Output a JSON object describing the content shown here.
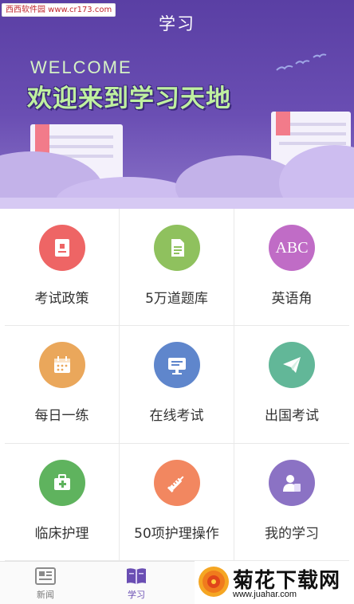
{
  "watermark_top": "西西软件园 www.cr173.com",
  "header": {
    "title": "学习"
  },
  "banner": {
    "welcome": "WELCOME",
    "headline": "欢迎来到学习天地"
  },
  "grid": [
    {
      "label": "考试政策",
      "icon": "document-icon",
      "color": "#ee6565"
    },
    {
      "label": "5万道题库",
      "icon": "file-icon",
      "color": "#8fc15e"
    },
    {
      "label": "英语角",
      "icon": "abc-icon",
      "text": "ABC",
      "color": "#c06cc6"
    },
    {
      "label": "每日一练",
      "icon": "calendar-icon",
      "color": "#eaa75b"
    },
    {
      "label": "在线考试",
      "icon": "monitor-icon",
      "color": "#5f86cc"
    },
    {
      "label": "出国考试",
      "icon": "paper-plane-icon",
      "color": "#62b798"
    },
    {
      "label": "临床护理",
      "icon": "medical-kit-icon",
      "color": "#5fb35e"
    },
    {
      "label": "50项护理操作",
      "icon": "syringe-icon",
      "color": "#f28760"
    },
    {
      "label": "我的学习",
      "icon": "user-icon",
      "color": "#8b72c4"
    }
  ],
  "tabbar": {
    "items": [
      {
        "label": "新闻",
        "icon": "newspaper-icon",
        "active": false
      },
      {
        "label": "学习",
        "icon": "book-icon",
        "active": true
      }
    ],
    "accent": "#6a4eb3"
  },
  "watermark_bottom": {
    "name": "菊花下载网",
    "url": "www.juahar.com"
  }
}
